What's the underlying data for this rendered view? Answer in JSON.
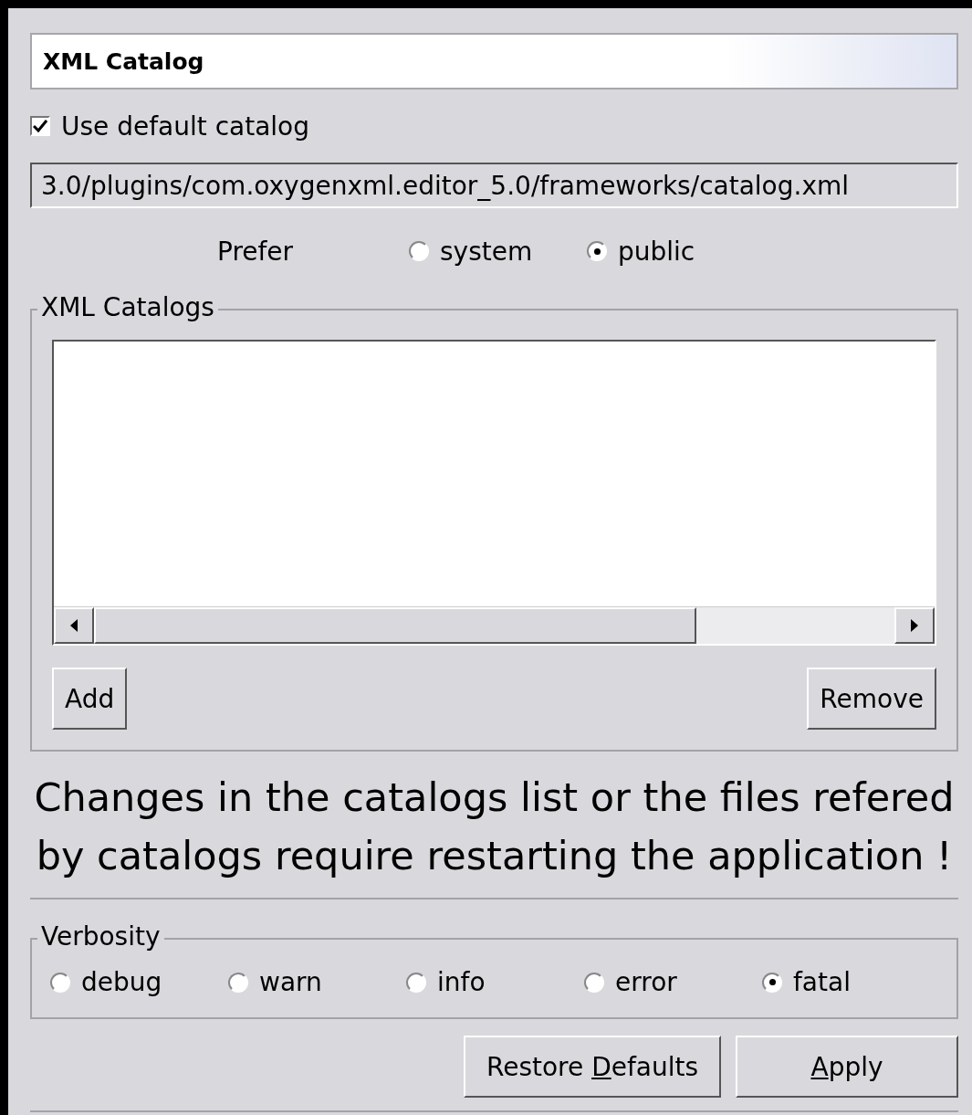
{
  "title": "XML Catalog",
  "use_default_catalog": {
    "label": "Use default catalog",
    "checked": true
  },
  "catalog_path": {
    "value": "3.0/plugins/com.oxygenxml.editor_5.0/frameworks/catalog.xml"
  },
  "prefer": {
    "label": "Prefer",
    "options": [
      {
        "label": "system",
        "selected": false
      },
      {
        "label": "public",
        "selected": true
      }
    ]
  },
  "xml_catalogs": {
    "legend": "XML Catalogs",
    "buttons": [
      "Add",
      "Remove"
    ]
  },
  "notice": "Changes in the catalogs list or the files refered by catalogs require restarting the application !",
  "verbosity": {
    "legend": "Verbosity",
    "options": [
      {
        "label": "debug",
        "selected": false
      },
      {
        "label": "warn",
        "selected": false
      },
      {
        "label": "info",
        "selected": false
      },
      {
        "label": "error",
        "selected": false
      },
      {
        "label": "fatal",
        "selected": true
      }
    ]
  },
  "footer_buttons": [
    {
      "label_parts": [
        {
          "text": "Restore ",
          "underlined": false
        },
        {
          "text": "D",
          "underlined": true
        },
        {
          "text": "efaults",
          "underlined": false
        }
      ]
    },
    {
      "label_parts": [
        {
          "text": "A",
          "underlined": true
        },
        {
          "text": "pply",
          "underlined": false
        }
      ]
    }
  ]
}
